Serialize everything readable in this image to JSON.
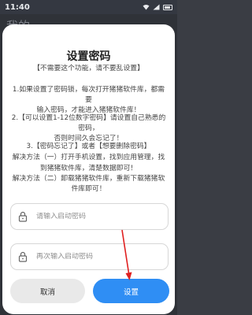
{
  "status_bar": {
    "time": "11:40",
    "icons": [
      "wifi-icon",
      "signal-icon",
      "battery-icon"
    ]
  },
  "app": {
    "header_text": "我的"
  },
  "dialog": {
    "title": "设置密码",
    "lines": [
      "【不需要这个功能，请不要乱设置】",
      "1.如果设置了密码锁，每次打开猪猪软件库，都需要输入密码，才能进入猪猪软件库！",
      "2.【可以设置1-12位数字密码】请设置自己熟悉的密码，否则时间久会忘记了！",
      "3.【密码忘记了】或者【想要删除密码】",
      "解决方法（一）打开手机设置，找到应用管理，找到猪猪软件库，清楚数据即可！",
      "解决方法（二）卸载猪猪软件库，重新下载猪猪软件库即可！"
    ],
    "line_breaks": {
      "l1": "【不需要这个功能，请不要乱设置】",
      "l2a": "1.如果设置了密码锁，每次打开猪猪软件库，都需要",
      "l2b": "输入密码，才能进入猪猪软件库！",
      "l3a": "2.【可以设置1-12位数字密码】请设置自己熟悉的密码，",
      "l3b": "否则时间久会忘记了！",
      "l4": "3.【密码忘记了】或者【想要删除密码】",
      "l5": "解决方法（一）打开手机设置，找到应用管理，找",
      "l6": "到猪猪软件库，清楚数据即可！",
      "l7": "解决方法（二）卸载猪猪软件库，重新下载猪猪软",
      "l8": "件库即可！"
    },
    "password_input": {
      "placeholder": "请输入启动密码",
      "value": ""
    },
    "confirm_input": {
      "placeholder": "再次输入启动密码",
      "value": ""
    },
    "cancel_label": "取消",
    "confirm_label": "设置"
  },
  "colors": {
    "accent": "#2f8ef4",
    "arrow": "#e02020",
    "cancel_bg": "#e9e9e9",
    "overlay": "#2f3238"
  }
}
